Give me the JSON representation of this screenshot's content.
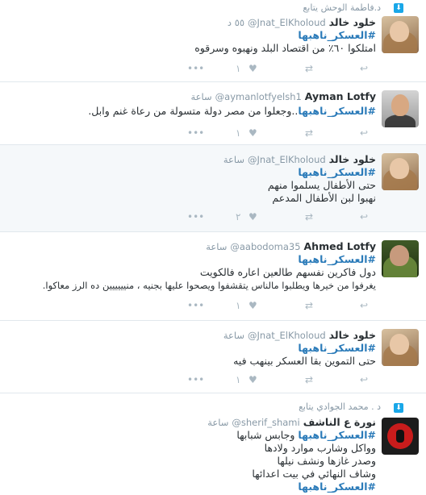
{
  "tweets": [
    {
      "retweeted_by": "د.فاطمة الوحش يتابع",
      "name": "خلود خالد",
      "handle": "@Jnat_ElKholoud",
      "time": "٥٥ د",
      "hashtag": "#العسكر_ناهبها",
      "lines": [
        "امتلكوا ٦٠٪ من اقتصاد البلد ونهبوه وسرقوه"
      ],
      "likes": "١",
      "retweets": "",
      "avatar": "woman-avatar"
    },
    {
      "retweeted_by": "",
      "name": "Ayman Lotfy",
      "handle": "@aymanlotfyelsh1",
      "time": "ساعة",
      "hashtag": "#العسكر_ناهبها",
      "lines": [
        "..وجعلوا من مصر دولة متسولة من رعاة غنم وابل."
      ],
      "inline_hashtag": true,
      "likes": "١",
      "retweets": "",
      "avatar": "man-avatar"
    },
    {
      "retweeted_by": "",
      "name": "خلود خالد",
      "handle": "@Jnat_ElKholoud",
      "time": "ساعة",
      "hashtag": "#العسكر_ناهبها",
      "lines": [
        "حتى الأطفال يسلموا منهم",
        "نهبوا لبن الأطفال المدعم"
      ],
      "likes": "٢",
      "retweets": "",
      "avatar": "woman-avatar"
    },
    {
      "retweeted_by": "",
      "name": "Ahmed Lotfy",
      "handle": "@aabodoma35",
      "time": "ساعة",
      "hashtag": "#العسكر_ناهبها",
      "lines": [
        "دول فاكرين نفسهم طالعين اعاره فالكويت",
        "يغرفوا من خيرها ويطلبوا مالناس يتقشفوا ويصحوا عليها بجنيه ، منيييييين ده الرز معاكوا."
      ],
      "likes": "١",
      "retweets": "",
      "avatar": "man-green-avatar"
    },
    {
      "retweeted_by": "",
      "name": "خلود خالد",
      "handle": "@Jnat_ElKholoud",
      "time": "ساعة",
      "hashtag": "#العسكر_ناهبها",
      "lines": [
        "حتى التموين بقا العسكر بينهب فيه"
      ],
      "likes": "١",
      "retweets": "",
      "avatar": "woman-avatar"
    },
    {
      "retweeted_by": "د . محمد الجوادي يتابع",
      "name": "نورة ع الناشف",
      "handle": "@sherif_shami",
      "time": "ساعة",
      "hashtag": "#العسكر_ناهبها",
      "lines": [
        "وجابس شبابها",
        "وواكل وشارب موارد ولادها",
        "وصدر غازها ونشف نيلها",
        "وشاف النهائي في بيت اعدائها"
      ],
      "trailing_hashtag": "#العسكر_ناهبها",
      "avatar": "logo-avatar"
    }
  ],
  "icons": {
    "reply": "reply-icon",
    "retweet": "retweet-icon",
    "like": "heart-icon",
    "more": "more-icon"
  },
  "colors": {
    "hashtag": "#2b7bb9",
    "meta": "#8899a6",
    "retweet_badge": "#19a7e8"
  }
}
